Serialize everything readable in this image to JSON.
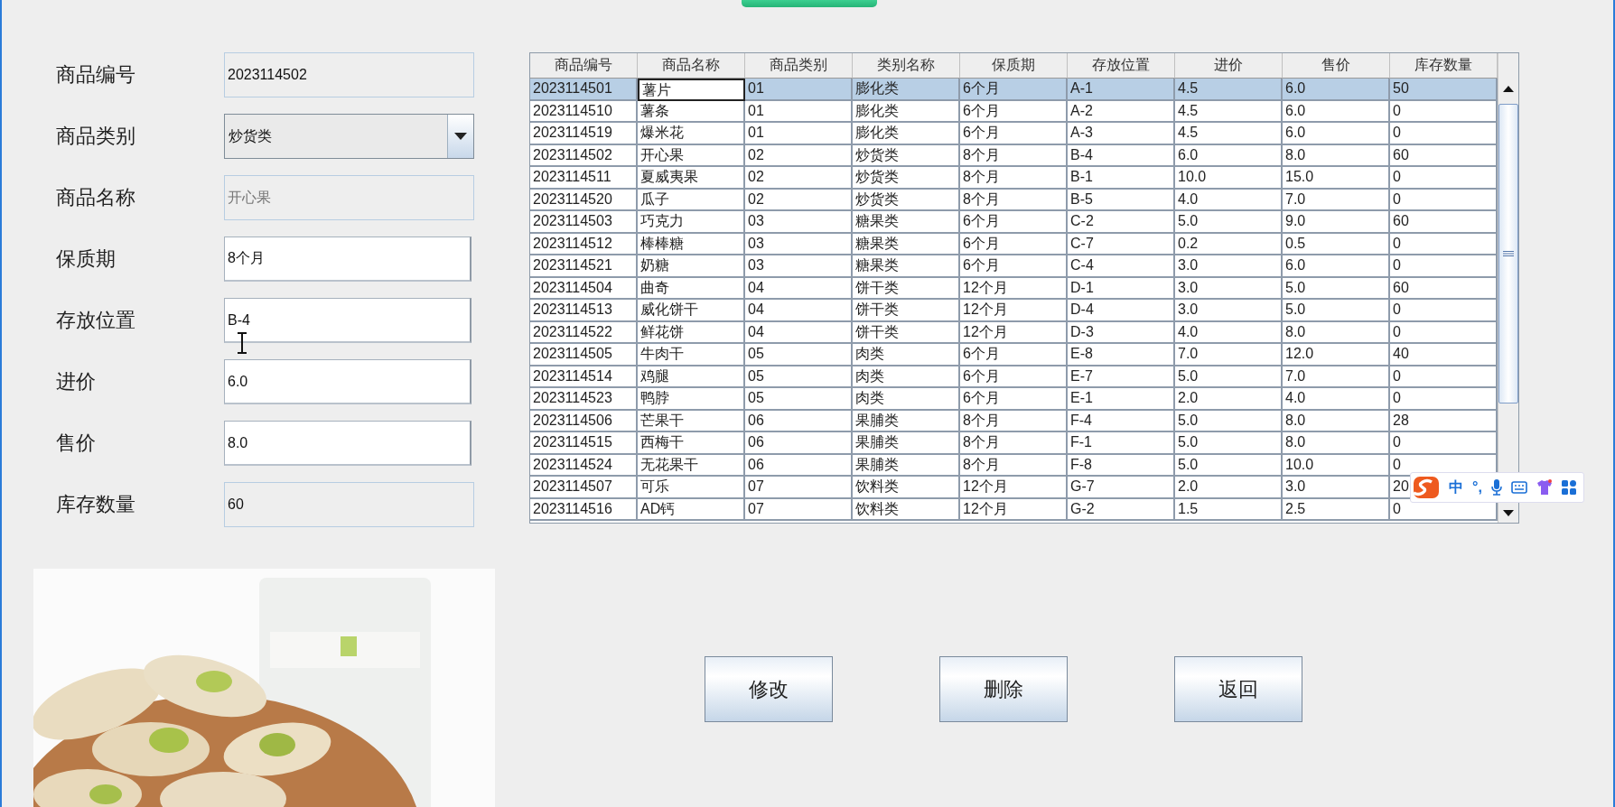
{
  "form": {
    "fields": [
      {
        "label": "商品编号",
        "value": "2023114502",
        "kind": "readonly"
      },
      {
        "label": "商品类别",
        "value": "炒货类",
        "kind": "combo"
      },
      {
        "label": "商品名称",
        "value": "开心果",
        "kind": "disabled"
      },
      {
        "label": "保质期",
        "value": "8个月",
        "kind": "text"
      },
      {
        "label": "存放位置",
        "value": "B-4",
        "kind": "text"
      },
      {
        "label": "进价",
        "value": "6.0",
        "kind": "text"
      },
      {
        "label": "售价",
        "value": "8.0",
        "kind": "text"
      },
      {
        "label": "库存数量",
        "value": "60",
        "kind": "readonly"
      }
    ]
  },
  "table": {
    "columns": [
      "商品编号",
      "商品名称",
      "商品类别",
      "类别名称",
      "保质期",
      "存放位置",
      "进价",
      "售价",
      "库存数量"
    ],
    "rows": [
      {
        "selected": true,
        "focused": true,
        "cells": [
          "2023114501",
          "薯片",
          "01",
          "膨化类",
          "6个月",
          "A-1",
          "4.5",
          "6.0",
          "50"
        ]
      },
      {
        "selected": false,
        "focused": false,
        "cells": [
          "2023114510",
          "薯条",
          "01",
          "膨化类",
          "6个月",
          "A-2",
          "4.5",
          "6.0",
          "0"
        ]
      },
      {
        "selected": false,
        "focused": false,
        "cells": [
          "2023114519",
          "爆米花",
          "01",
          "膨化类",
          "6个月",
          "A-3",
          "4.5",
          "6.0",
          "0"
        ]
      },
      {
        "selected": false,
        "focused": false,
        "cells": [
          "2023114502",
          "开心果",
          "02",
          "炒货类",
          "8个月",
          "B-4",
          "6.0",
          "8.0",
          "60"
        ]
      },
      {
        "selected": false,
        "focused": false,
        "cells": [
          "2023114511",
          "夏威夷果",
          "02",
          "炒货类",
          "8个月",
          "B-1",
          "10.0",
          "15.0",
          "0"
        ]
      },
      {
        "selected": false,
        "focused": false,
        "cells": [
          "2023114520",
          "瓜子",
          "02",
          "炒货类",
          "8个月",
          "B-5",
          "4.0",
          "7.0",
          "0"
        ]
      },
      {
        "selected": false,
        "focused": false,
        "cells": [
          "2023114503",
          "巧克力",
          "03",
          "糖果类",
          "6个月",
          "C-2",
          "5.0",
          "9.0",
          "60"
        ]
      },
      {
        "selected": false,
        "focused": false,
        "cells": [
          "2023114512",
          "棒棒糖",
          "03",
          "糖果类",
          "6个月",
          "C-7",
          "0.2",
          "0.5",
          "0"
        ]
      },
      {
        "selected": false,
        "focused": false,
        "cells": [
          "2023114521",
          "奶糖",
          "03",
          "糖果类",
          "6个月",
          "C-4",
          "3.0",
          "6.0",
          "0"
        ]
      },
      {
        "selected": false,
        "focused": false,
        "cells": [
          "2023114504",
          "曲奇",
          "04",
          "饼干类",
          "12个月",
          "D-1",
          "3.0",
          "5.0",
          "60"
        ]
      },
      {
        "selected": false,
        "focused": false,
        "cells": [
          "2023114513",
          "威化饼干",
          "04",
          "饼干类",
          "12个月",
          "D-4",
          "3.0",
          "5.0",
          "0"
        ]
      },
      {
        "selected": false,
        "focused": false,
        "cells": [
          "2023114522",
          "鲜花饼",
          "04",
          "饼干类",
          "12个月",
          "D-3",
          "4.0",
          "8.0",
          "0"
        ]
      },
      {
        "selected": false,
        "focused": false,
        "cells": [
          "2023114505",
          "牛肉干",
          "05",
          "肉类",
          "6个月",
          "E-8",
          "7.0",
          "12.0",
          "40"
        ]
      },
      {
        "selected": false,
        "focused": false,
        "cells": [
          "2023114514",
          "鸡腿",
          "05",
          "肉类",
          "6个月",
          "E-7",
          "5.0",
          "7.0",
          "0"
        ]
      },
      {
        "selected": false,
        "focused": false,
        "cells": [
          "2023114523",
          "鸭脖",
          "05",
          "肉类",
          "6个月",
          "E-1",
          "2.0",
          "4.0",
          "0"
        ]
      },
      {
        "selected": false,
        "focused": false,
        "cells": [
          "2023114506",
          "芒果干",
          "06",
          "果脯类",
          "8个月",
          "F-4",
          "5.0",
          "8.0",
          "28"
        ]
      },
      {
        "selected": false,
        "focused": false,
        "cells": [
          "2023114515",
          "西梅干",
          "06",
          "果脯类",
          "8个月",
          "F-1",
          "5.0",
          "8.0",
          "0"
        ]
      },
      {
        "selected": false,
        "focused": false,
        "cells": [
          "2023114524",
          "无花果干",
          "06",
          "果脯类",
          "8个月",
          "F-8",
          "5.0",
          "10.0",
          "0"
        ]
      },
      {
        "selected": false,
        "focused": false,
        "cells": [
          "2023114507",
          "可乐",
          "07",
          "饮料类",
          "12个月",
          "G-7",
          "2.0",
          "3.0",
          "20"
        ]
      },
      {
        "selected": false,
        "focused": false,
        "cells": [
          "2023114516",
          "AD钙",
          "07",
          "饮料类",
          "12个月",
          "G-2",
          "1.5",
          "2.5",
          "0"
        ]
      }
    ]
  },
  "buttons": [
    "修改",
    "删除",
    "返回"
  ],
  "ime_toolbar": {
    "mode": "中",
    "punctuation": "°,"
  }
}
